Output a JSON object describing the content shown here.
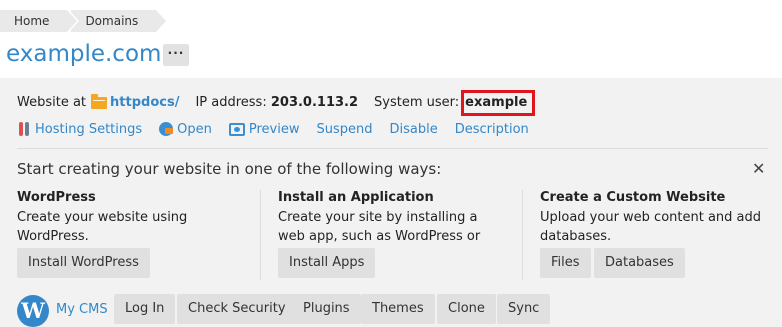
{
  "breadcrumb": {
    "home": "Home",
    "domains": "Domains"
  },
  "title": "example.com",
  "more_label": "···",
  "info": {
    "website_at_label": "Website at",
    "docroot": "httpdocs/",
    "ip_label": "IP address:",
    "ip_value": "203.0.113.2",
    "sysuser_label": "System user:",
    "sysuser_value": "example"
  },
  "actions": {
    "hosting_settings": "Hosting Settings",
    "open": "Open",
    "preview": "Preview",
    "suspend": "Suspend",
    "disable": "Disable",
    "description": "Description"
  },
  "start": {
    "heading": "Start creating your website in one of the following ways:",
    "close": "✕",
    "wordpress": {
      "title": "WordPress",
      "text": "Create your website using WordPress.",
      "button": "Install WordPress"
    },
    "app": {
      "title": "Install an Application",
      "text": "Create your site by installing a web app, such as WordPress or Drupal.",
      "button": "Install Apps"
    },
    "custom": {
      "title": "Create a Custom Website",
      "text": "Upload your web content and add databases.",
      "files_button": "Files",
      "databases_button": "Databases"
    }
  },
  "cms": {
    "logo": "W",
    "label": "My CMS",
    "buttons": {
      "login": "Log In",
      "check_security": "Check Security",
      "plugins": "Plugins",
      "themes": "Themes",
      "clone": "Clone",
      "sync": "Sync"
    }
  },
  "colors": {
    "link": "#3487c8",
    "highlight": "#e0161f",
    "panel_bg": "#f2f2f2",
    "button_bg": "#e0e0e0"
  }
}
